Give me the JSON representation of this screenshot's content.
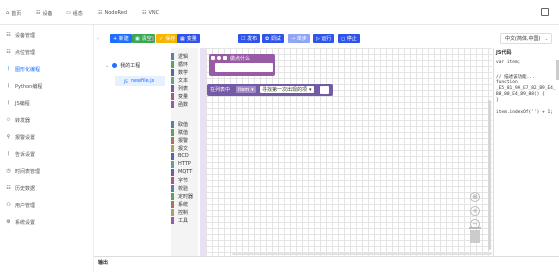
{
  "topnav": [
    {
      "icon": "⌂",
      "label": "首页"
    },
    {
      "icon": "☷",
      "label": "设备"
    },
    {
      "icon": "▭",
      "label": "组态"
    },
    {
      "icon": "☷",
      "label": "NodeRed"
    },
    {
      "icon": "☷",
      "label": "VNC"
    }
  ],
  "sidebar": [
    {
      "icon": "☷",
      "label": "设备管理"
    },
    {
      "icon": "☷",
      "label": "点位管理"
    },
    {
      "icon": "⟩",
      "label": "图形化编程"
    },
    {
      "icon": "⟩",
      "label": "Python编程"
    },
    {
      "icon": "⟩",
      "label": "JS编程"
    },
    {
      "icon": "♲",
      "label": "转发器"
    },
    {
      "icon": "⚲",
      "label": "报警设置"
    },
    {
      "icon": "⟩",
      "label": "告诉设置"
    },
    {
      "icon": "◷",
      "label": "时间表管理"
    },
    {
      "icon": "☷",
      "label": "历史数据"
    },
    {
      "icon": "⚇",
      "label": "用户管理"
    },
    {
      "icon": "⚙",
      "label": "系统设置"
    }
  ],
  "toolbar": {
    "new": "+ 新建",
    "clear": "清空",
    "save": "保存",
    "vars": "变量",
    "publish": "☐ 发布",
    "debug": "✿ 调试",
    "step": "→ 单步",
    "run": "▷ 运行",
    "stop": "◻ 停止"
  },
  "tree": {
    "root": "我的工程",
    "file": "newfile.js"
  },
  "categories": [
    {
      "label": "逻辑",
      "color": "#5b80a5"
    },
    {
      "label": "循环",
      "color": "#5ba55b"
    },
    {
      "label": "数学",
      "color": "#5b67a5"
    },
    {
      "label": "文本",
      "color": "#5ba58c"
    },
    {
      "label": "列表",
      "color": "#745ba5"
    },
    {
      "label": "变量",
      "color": "#a55b80"
    },
    {
      "label": "函数",
      "color": "#995ba5"
    },
    {
      "label": "",
      "color": "#ffffff"
    },
    {
      "label": "取值",
      "color": "#5b80a5"
    },
    {
      "label": "赋值",
      "color": "#5ba55b"
    },
    {
      "label": "报警",
      "color": "#a5745b"
    },
    {
      "label": "报文",
      "color": "#a5a55b"
    },
    {
      "label": "BCD",
      "color": "#5b67a5"
    },
    {
      "label": "HTTP",
      "color": "#5ba58c"
    },
    {
      "label": "MQTT",
      "color": "#745ba5"
    },
    {
      "label": "字节",
      "color": "#a55b80"
    },
    {
      "label": "校验",
      "color": "#5b80a5"
    },
    {
      "label": "定时器",
      "color": "#5ba55b"
    },
    {
      "label": "系统",
      "color": "#a5745b"
    },
    {
      "label": "控制",
      "color": "#a5a55b"
    },
    {
      "label": "工具",
      "color": "#995ba5"
    }
  ],
  "blocks": {
    "func_label": "做点什么",
    "list_prefix": "在列表中",
    "list_var": "item",
    "list_op": "寻找第一次出现的项"
  },
  "code": {
    "lang_select": "中文(简体,中国)",
    "title": "JS代码",
    "lines": [
      "var item;",
      "",
      "// 描述该功能...",
      "function",
      "_E5_81_9A_E7_82_B9_E4_",
      "B8_80_E4_B9_88() {",
      "}",
      "",
      "item.indexOf('') + 1;"
    ]
  },
  "output_label": "输出"
}
